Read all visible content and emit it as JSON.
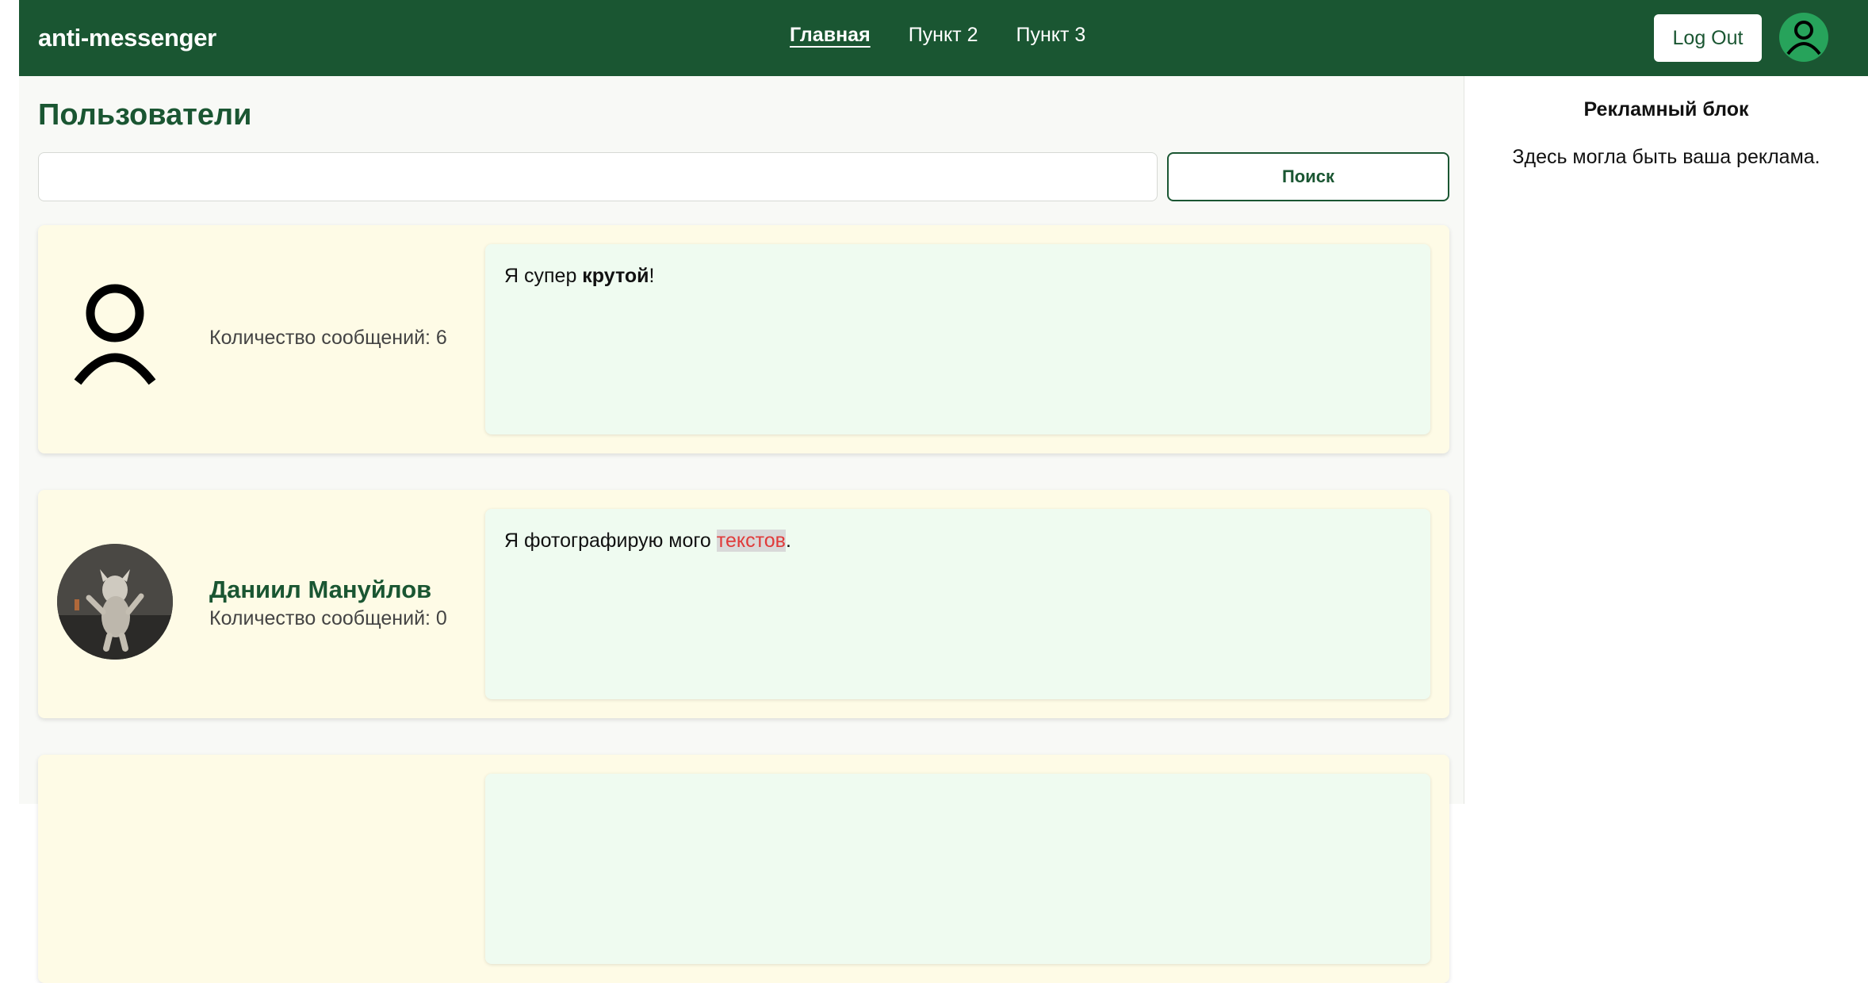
{
  "header": {
    "brand": "anti-messenger",
    "nav": [
      {
        "label": "Главная",
        "active": true
      },
      {
        "label": "Пункт 2",
        "active": false
      },
      {
        "label": "Пункт 3",
        "active": false
      }
    ],
    "logout_label": "Log Out",
    "avatar_icon": "user-icon"
  },
  "main": {
    "title": "Пользователи",
    "search": {
      "value": "",
      "placeholder": "",
      "button_label": "Поиск"
    },
    "users": [
      {
        "name": "",
        "avatar": "default-user-icon",
        "message_count_label": "Количество сообщений: 6",
        "message": {
          "before": "Я супер ",
          "bold": "крутой",
          "after": "!"
        }
      },
      {
        "name": "Даниил Мануйлов",
        "avatar": "user-photo",
        "message_count_label": "Количество сообщений: 0",
        "message": {
          "before": "Я фотографирую мого ",
          "highlight": "текстов",
          "after": "."
        }
      },
      {
        "name": "",
        "avatar": "",
        "message_count_label": "",
        "message": {
          "before": ""
        }
      }
    ]
  },
  "sidebar": {
    "title": "Рекламный блок",
    "text": "Здесь могла быть ваша реклама."
  },
  "colors": {
    "brand_green": "#1a5632",
    "card_bg": "#fefbe6",
    "message_bg": "#effbf0",
    "highlight_text": "#e03a3a"
  }
}
